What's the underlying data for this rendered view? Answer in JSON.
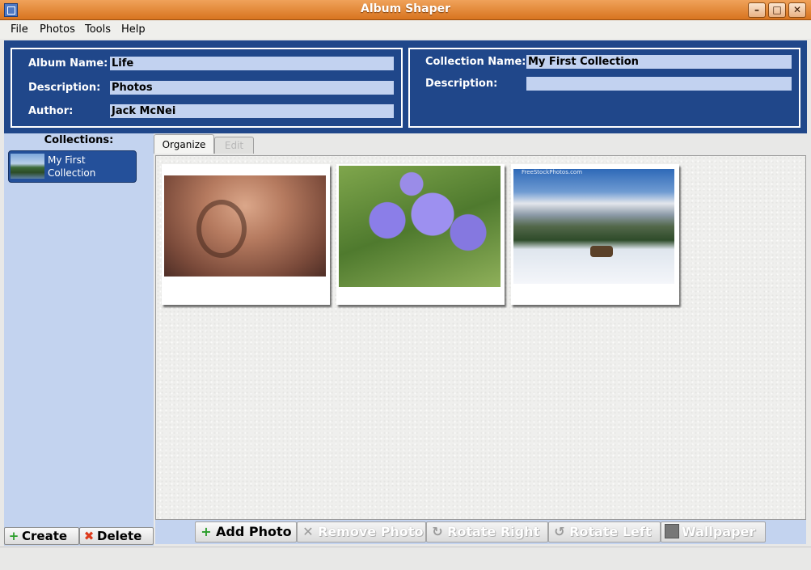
{
  "window": {
    "title": "Album Shaper"
  },
  "window_controls": {
    "minimize": "–",
    "maximize": "□",
    "close": "✕"
  },
  "menu": [
    "File",
    "Photos",
    "Tools",
    "Help"
  ],
  "album": {
    "name_label": "Album Name:",
    "name": "Life",
    "description_label": "Description:",
    "description": "Photos",
    "author_label": "Author:",
    "author": "Jack McNei"
  },
  "collection": {
    "name_label": "Collection Name:",
    "name": "My First Collection",
    "description_label": "Description:",
    "description": ""
  },
  "sidebar": {
    "title": "Collections:",
    "items": [
      {
        "label": "My First Collection",
        "selected": true
      }
    ],
    "create_label": "Create",
    "delete_label": "Delete"
  },
  "tabs": [
    {
      "label": "Organize",
      "active": true
    },
    {
      "label": "Edit",
      "active": false,
      "disabled": true
    }
  ],
  "photos": [
    {
      "subject": "rust-swirl"
    },
    {
      "subject": "purple-flowers"
    },
    {
      "subject": "snowy-mountains-deer",
      "caption": "FreeStockPhotos.com"
    }
  ],
  "toolbar": {
    "add_photo": "Add Photo",
    "remove_photo": "Remove Photo",
    "rotate_right": "Rotate Right",
    "rotate_left": "Rotate Left",
    "wallpaper": "Wallpaper"
  },
  "colors": {
    "titlebar": "#e08a3a",
    "header_blue": "#20478a",
    "panel_blue": "#c3d3ef",
    "selected_blue": "#24509a"
  }
}
